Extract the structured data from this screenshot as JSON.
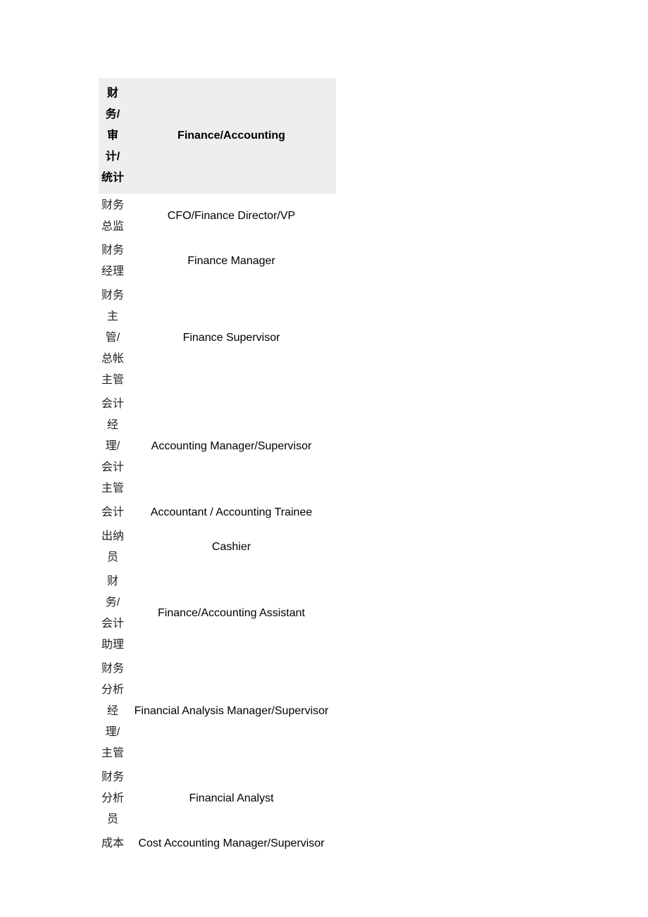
{
  "table": {
    "header": {
      "cn": "财务/审计/统计",
      "en": "Finance/Accounting"
    },
    "rows": [
      {
        "cn": "财务总监",
        "en": "CFO/Finance Director/VP"
      },
      {
        "cn": "财务经理",
        "en": "Finance Manager"
      },
      {
        "cn": "财务主管/总帐主管",
        "en": "Finance Supervisor"
      },
      {
        "cn": "会计经理/会计主管",
        "en": "Accounting Manager/Supervisor"
      },
      {
        "cn": "会计",
        "en": "Accountant / Accounting Trainee"
      },
      {
        "cn": "出纳员",
        "en": "Cashier"
      },
      {
        "cn": "财务/会计助理",
        "en": "Finance/Accounting Assistant"
      },
      {
        "cn": "财务分析经理/主管",
        "en": "Financial Analysis Manager/Supervisor"
      },
      {
        "cn": "财务分析员",
        "en": "Financial Analyst"
      },
      {
        "cn": "成本",
        "en": "Cost Accounting Manager/Supervisor"
      }
    ]
  }
}
